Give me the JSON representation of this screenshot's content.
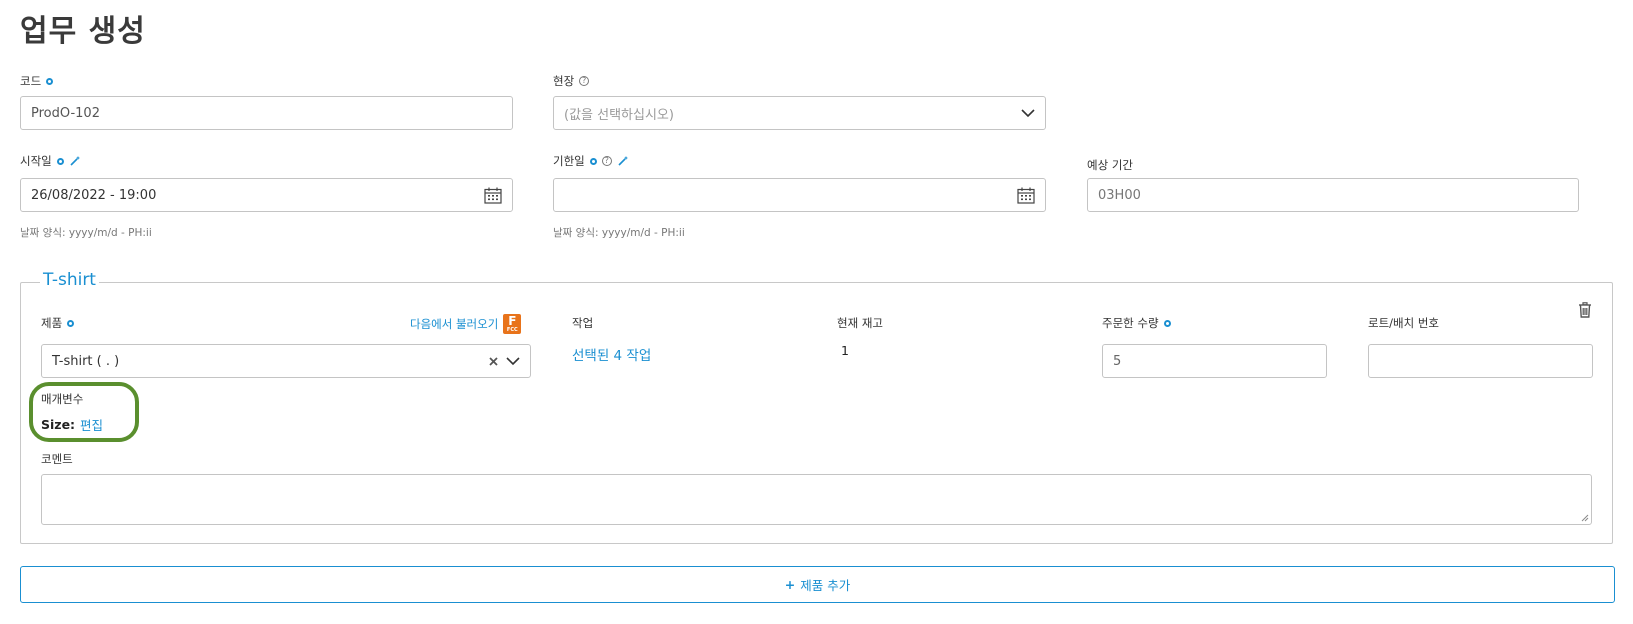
{
  "page": {
    "title": "업무 생성"
  },
  "code": {
    "label": "코드",
    "value": "ProdO-102"
  },
  "site": {
    "label": "현장",
    "placeholder": "(값을 선택하십시오)"
  },
  "start_date": {
    "label": "시작일",
    "value": "26/08/2022 - 19:00",
    "hint": "날짜 양식: yyyy/m/d - PH:ii"
  },
  "due_date": {
    "label": "기한일",
    "value": "",
    "hint": "날짜 양식: yyyy/m/d - PH:ii"
  },
  "expected_duration": {
    "label": "예상 기간",
    "value": "03H00"
  },
  "product_block": {
    "legend": "T-shirt",
    "product_label": "제품",
    "load_from_label": "다음에서 불러오기",
    "fcc_letter": "F",
    "fcc_sub": "FCC",
    "product_value": "T-shirt ( . )",
    "task_label": "작업",
    "task_value": "선택된 4 작업",
    "stock_label": "현재 재고",
    "stock_value": "1",
    "ordered_qty_label": "주문한 수량",
    "ordered_qty_value": "5",
    "lot_label": "로트/배치 번호",
    "lot_value": "",
    "params_label": "매개변수",
    "param_name": "Size:",
    "param_edit": "편집",
    "comment_label": "코멘트"
  },
  "add_product_button": {
    "icon": "+",
    "label": "제품 추가"
  },
  "colors": {
    "accent": "#1a8fd1",
    "highlight": "#5a8f2e",
    "fcc": "#e8731a"
  }
}
